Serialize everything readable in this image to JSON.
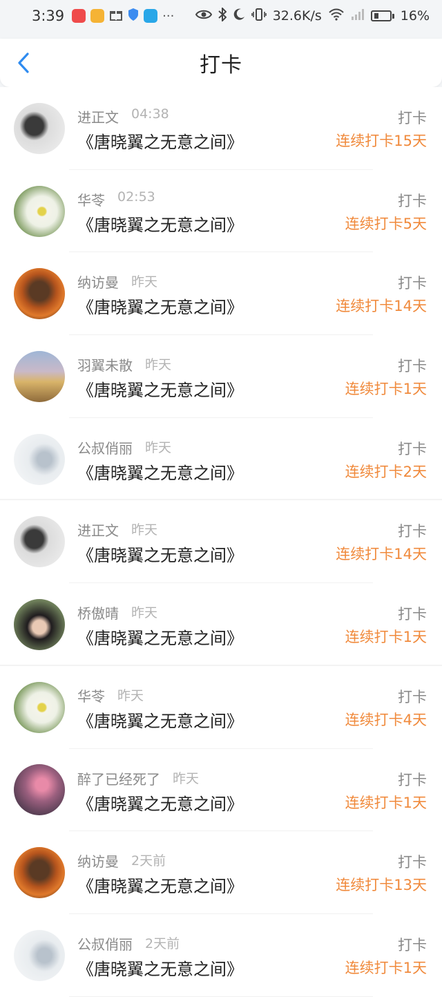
{
  "status_bar": {
    "time": "3:39",
    "network_speed": "32.6K/s",
    "battery": "16%",
    "icons": [
      "huawei-app-icon",
      "weibo-icon",
      "gift-icon",
      "shield-icon",
      "search-app-icon",
      "more-dots-icon",
      "eye-icon",
      "bluetooth-icon",
      "moon-icon",
      "vibrate-icon",
      "wifi-icon",
      "signal-icon",
      "battery-icon"
    ]
  },
  "header": {
    "title": "打卡",
    "back_icon": "chevron-left-icon"
  },
  "colors": {
    "accent_orange": "#f08a3c",
    "back_blue": "#2e8bf0"
  },
  "entries": [
    {
      "user": "进正文",
      "time": "04:38",
      "book": "《唐晓翼之无意之间》",
      "action": "打卡",
      "streak": "连续打卡15天"
    },
    {
      "user": "华苓",
      "time": "02:53",
      "book": "《唐晓翼之无意之间》",
      "action": "打卡",
      "streak": "连续打卡5天"
    },
    {
      "user": "纳访曼",
      "time": "昨天",
      "book": "《唐晓翼之无意之间》",
      "action": "打卡",
      "streak": "连续打卡14天"
    },
    {
      "user": "羽翼未散",
      "time": "昨天",
      "book": "《唐晓翼之无意之间》",
      "action": "打卡",
      "streak": "连续打卡1天"
    },
    {
      "user": "公叔俏丽",
      "time": "昨天",
      "book": "《唐晓翼之无意之间》",
      "action": "打卡",
      "streak": "连续打卡2天"
    },
    {
      "user": "进正文",
      "time": "昨天",
      "book": "《唐晓翼之无意之间》",
      "action": "打卡",
      "streak": "连续打卡14天"
    },
    {
      "user": "桥傲晴",
      "time": "昨天",
      "book": "《唐晓翼之无意之间》",
      "action": "打卡",
      "streak": "连续打卡1天"
    },
    {
      "user": "华苓",
      "time": "昨天",
      "book": "《唐晓翼之无意之间》",
      "action": "打卡",
      "streak": "连续打卡4天"
    },
    {
      "user": "醉了已经死了",
      "time": "昨天",
      "book": "《唐晓翼之无意之间》",
      "action": "打卡",
      "streak": "连续打卡1天"
    },
    {
      "user": "纳访曼",
      "time": "2天前",
      "book": "《唐晓翼之无意之间》",
      "action": "打卡",
      "streak": "连续打卡13天"
    },
    {
      "user": "公叔俏丽",
      "time": "2天前",
      "book": "《唐晓翼之无意之间》",
      "action": "打卡",
      "streak": "连续打卡1天"
    }
  ]
}
